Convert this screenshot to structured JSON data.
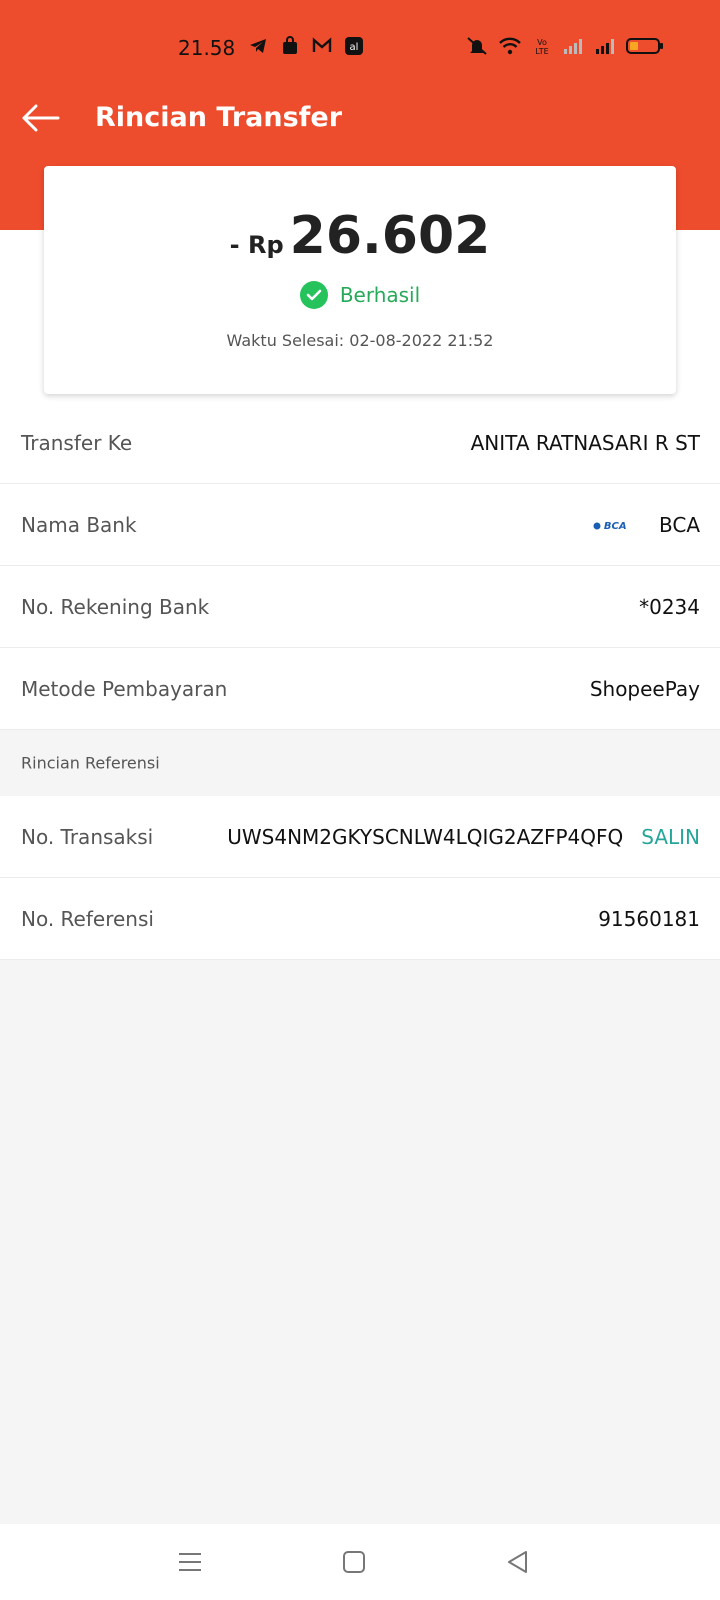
{
  "status_bar": {
    "time": "21.58",
    "left_icons": [
      "telegram-icon",
      "shop-icon",
      "gmail-icon",
      "app-icon"
    ],
    "right_icons": [
      "mute-icon",
      "wifi-icon",
      "volte-icon",
      "signal-icon",
      "signal-icon",
      "battery-icon"
    ]
  },
  "app_bar": {
    "title": "Rincian Transfer"
  },
  "summary": {
    "amount_prefix": "- Rp",
    "amount": "26.602",
    "status": "Berhasil",
    "completion_time": "Waktu Selesai: 02-08-2022 21:52"
  },
  "details": [
    {
      "label": "Transfer Ke",
      "value": "ANITA RATNASARI R ST"
    },
    {
      "label": "Nama Bank",
      "value": "BCA",
      "logo_text": "BCA"
    },
    {
      "label": "No. Rekening Bank",
      "value": "*0234"
    },
    {
      "label": "Metode Pembayaran",
      "value": "ShopeePay"
    }
  ],
  "reference_section": {
    "title": "Rincian Referensi",
    "rows": [
      {
        "label": "No. Transaksi",
        "value": "UWS4NM2GKYSCNLW4LQIG2AZFP4QFQ",
        "action": "SALIN"
      },
      {
        "label": "No. Referensi",
        "value": "91560181"
      }
    ]
  },
  "colors": {
    "brand": "#ee4d2d",
    "success": "#26c35c",
    "copy_action": "#26a69a"
  },
  "nav_bar": [
    "menu-icon",
    "home-icon",
    "back-icon"
  ]
}
